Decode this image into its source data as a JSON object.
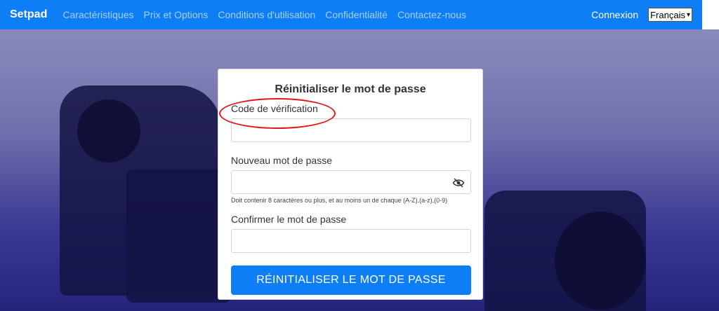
{
  "navbar": {
    "brand": "Setpad",
    "links": [
      "Caractéristiques",
      "Prix et Options",
      "Conditions d'utilisation",
      "Confidentialité",
      "Contactez-nous"
    ],
    "login": "Connexion",
    "language": "Français",
    "bg_color": "#0d7ef5"
  },
  "form": {
    "title": "Réinitialiser le mot de passe",
    "code_label": "Code de vérification",
    "new_password_label": "Nouveau mot de passe",
    "password_hint": "Doit contenir 8 caractères ou plus, et au moins un de chaque (A-Z),(a-z),(0-9)",
    "confirm_label": "Confirmer le mot de passe",
    "submit_label": "RÉINITIALISER LE MOT DE PASSE",
    "code_value": "",
    "new_password_value": "",
    "confirm_value": ""
  },
  "icons": {
    "password_toggle": "eye-slash-icon",
    "language_dropdown": "chevron-down-icon"
  },
  "annotation": {
    "highlight_color": "#e0141a"
  }
}
